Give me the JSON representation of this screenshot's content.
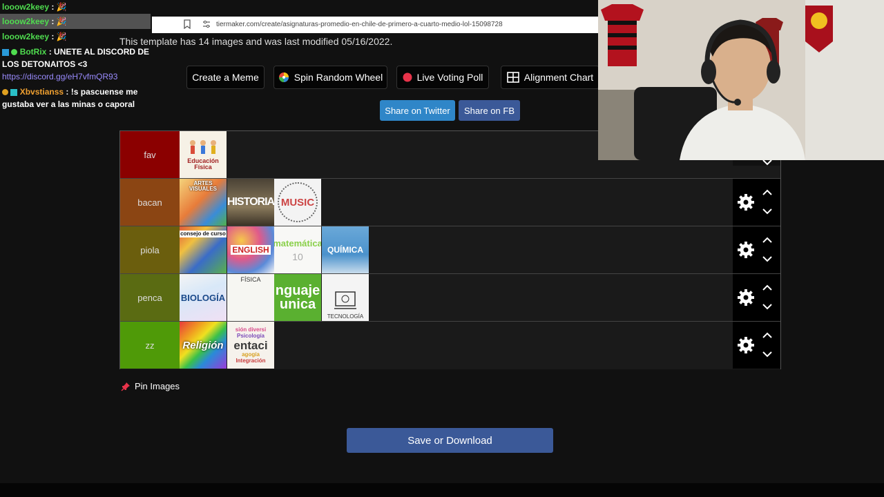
{
  "browser": {
    "url": "tiermaker.com/create/asignaturas-promedio-en-chile-de-primero-a-cuarto-medio-lol-15098728"
  },
  "template_info": "This template has 14 images and was last modified 05/16/2022.",
  "toolbar": {
    "create_meme": "Create a Meme",
    "spin_wheel": "Spin Random Wheel",
    "voting_poll": "Live Voting Poll",
    "alignment_chart": "Alignment Chart"
  },
  "share": {
    "twitter": "Share on Twitter",
    "fb": "Share on FB"
  },
  "tiers": [
    {
      "label": "fav",
      "color": "#8b0000"
    },
    {
      "label": "bacan",
      "color": "#8b4513"
    },
    {
      "label": "piola",
      "color": "#6b5e0d"
    },
    {
      "label": "penca",
      "color": "#5a6b12"
    },
    {
      "label": "zz",
      "color": "#4f9a08"
    }
  ],
  "tiles": {
    "educacion_fisica": "Educación Física",
    "artes_visuales": "ARTES VISUALES",
    "historia": "HISTORIA",
    "music": "MUSIC",
    "consejo": "consejo de curso",
    "english": "ENGLISH",
    "matematica": "matemática",
    "matematica_10": "10",
    "quimica": "QUÍMICA",
    "biologia": "BIOLOGÍA",
    "fisica": "FÍSICA",
    "lenguaje_1": "nguaje",
    "lenguaje_2": "unica",
    "tecnologia": "TECNOLOGÍA",
    "religion": "Religión",
    "orientacion_1": "sión diversi",
    "orientacion_2": "Psicología",
    "orientacion_3": "entaci",
    "orientacion_4": "agogía",
    "orientacion_5": "Integración"
  },
  "pin_images": "Pin Images",
  "save_button": "Save or Download",
  "chat": {
    "lines": [
      {
        "user": "looow2keey",
        "text": "",
        "color": "#4fdc4f"
      },
      {
        "user": "looow2keey",
        "text": "",
        "color": "#4fdc4f"
      },
      {
        "user": "looow2keey",
        "text": "",
        "color": "#4fdc4f"
      }
    ],
    "botrix": {
      "user": "BotRix",
      "text": "UNETE AL DISCORD DE",
      "text2": "LOS DETONAITOS <3",
      "link": "https://discord.gg/eH7vfmQR93",
      "color": "#4fdc4f",
      "link_color": "#9b8cff"
    },
    "xbvstianss": {
      "user": "Xbvstianss",
      "text": "!s pascuense me",
      "text2": "gustaba ver a las minas o caporal",
      "color": "#f0a030"
    }
  }
}
